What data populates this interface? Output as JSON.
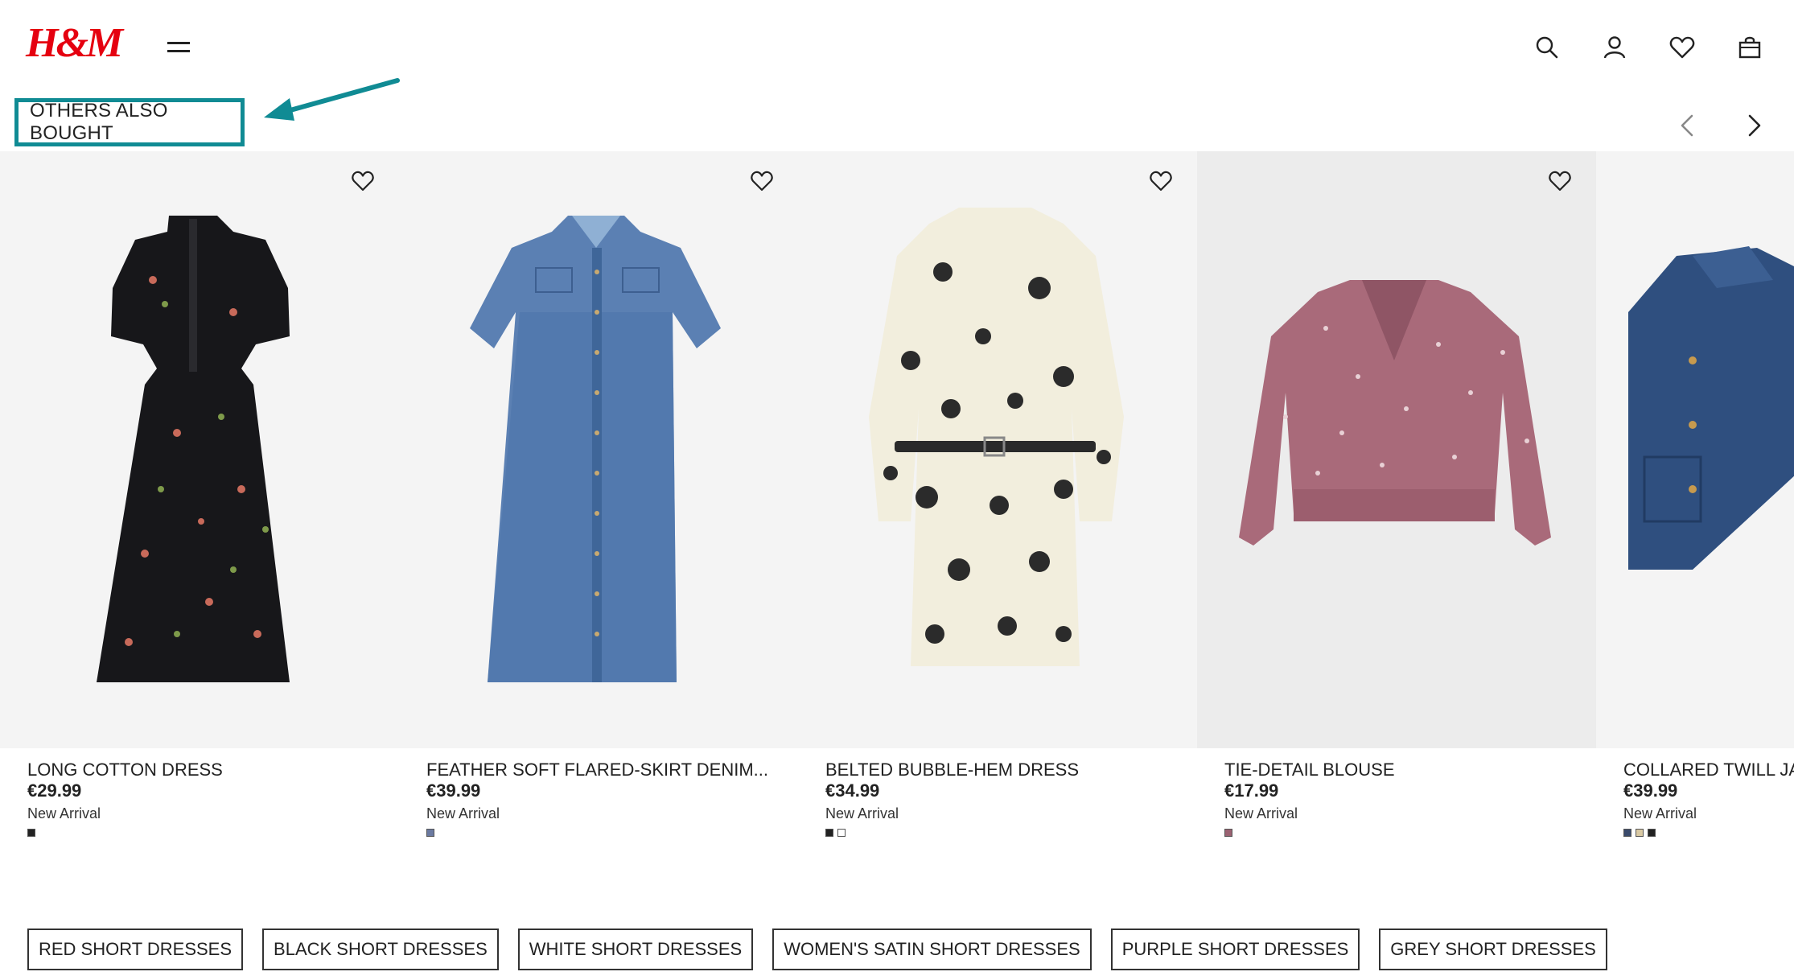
{
  "header": {
    "logo": "H&M"
  },
  "section": {
    "title": "OTHERS ALSO BOUGHT"
  },
  "colors": {
    "accent": "#108b94",
    "brand": "#e50010"
  },
  "products": [
    {
      "name": "LONG COTTON DRESS",
      "price": "€29.99",
      "tag": "New Arrival",
      "swatches": [
        "#222222"
      ]
    },
    {
      "name": "FEATHER SOFT FLARED-SKIRT DENIM...",
      "price": "€39.99",
      "tag": "New Arrival",
      "swatches": [
        "#6b7aa1"
      ]
    },
    {
      "name": "BELTED BUBBLE-HEM DRESS",
      "price": "€34.99",
      "tag": "New Arrival",
      "swatches": [
        "#222222",
        "#ffffff"
      ]
    },
    {
      "name": "TIE-DETAIL BLOUSE",
      "price": "€17.99",
      "tag": "New Arrival",
      "swatches": [
        "#9b6272"
      ]
    },
    {
      "name": "COLLARED TWILL JA",
      "price": "€39.99",
      "tag": "New Arrival",
      "swatches": [
        "#3a4a6b",
        "#d9c9a3",
        "#222222"
      ]
    }
  ],
  "chips": [
    "RED SHORT DRESSES",
    "BLACK SHORT DRESSES",
    "WHITE SHORT DRESSES",
    "WOMEN'S SATIN SHORT DRESSES",
    "PURPLE SHORT DRESSES",
    "GREY SHORT DRESSES"
  ]
}
